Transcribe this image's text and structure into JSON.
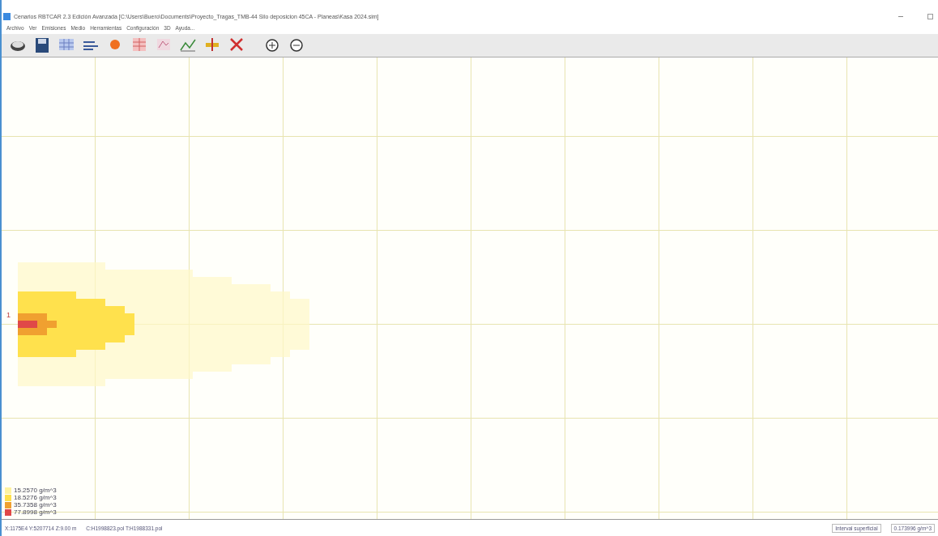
{
  "window": {
    "title": "Cenarios RBTCAR 2.3 Edición Avanzada [C:\\Users\\Buero\\Documents\\Proyecto_Tragas_TMB-44 Silo deposicion 45CA - Planeas\\Kasa 2024.sim]"
  },
  "menu": [
    "Archivo",
    "Ver",
    "Emisiones",
    "Medio",
    "Herramientas",
    "Configuración",
    "3D",
    "Ayuda..."
  ],
  "toolbar": [
    {
      "kind": "disk"
    },
    {
      "kind": "save"
    },
    {
      "kind": "grid"
    },
    {
      "kind": "wind"
    },
    {
      "kind": "source"
    },
    {
      "kind": "table"
    },
    {
      "kind": "map"
    },
    {
      "kind": "chart"
    },
    {
      "kind": "scale"
    },
    {
      "kind": "delete"
    },
    {
      "kind": "zoomin"
    },
    {
      "kind": "zoomout"
    }
  ],
  "map": {
    "source_label": "1",
    "legend": [
      {
        "label": "15.2570 g/m^3",
        "color": "#fff3a0"
      },
      {
        "label": "18.5276 g/m^3",
        "color": "#ffe14d"
      },
      {
        "label": "35.7358 g/m^3",
        "color": "#f0a030"
      },
      {
        "label": "77.8998 g/m^3",
        "color": "#e04848"
      }
    ]
  },
  "status_bar": {
    "coords": "X:1175E4 Y:5207714 Z:9.00 m",
    "files": "C:H1998823.pol T:H1988331.pol",
    "mode": "Interval superficial",
    "value": "0.173996 g/m^3"
  }
}
